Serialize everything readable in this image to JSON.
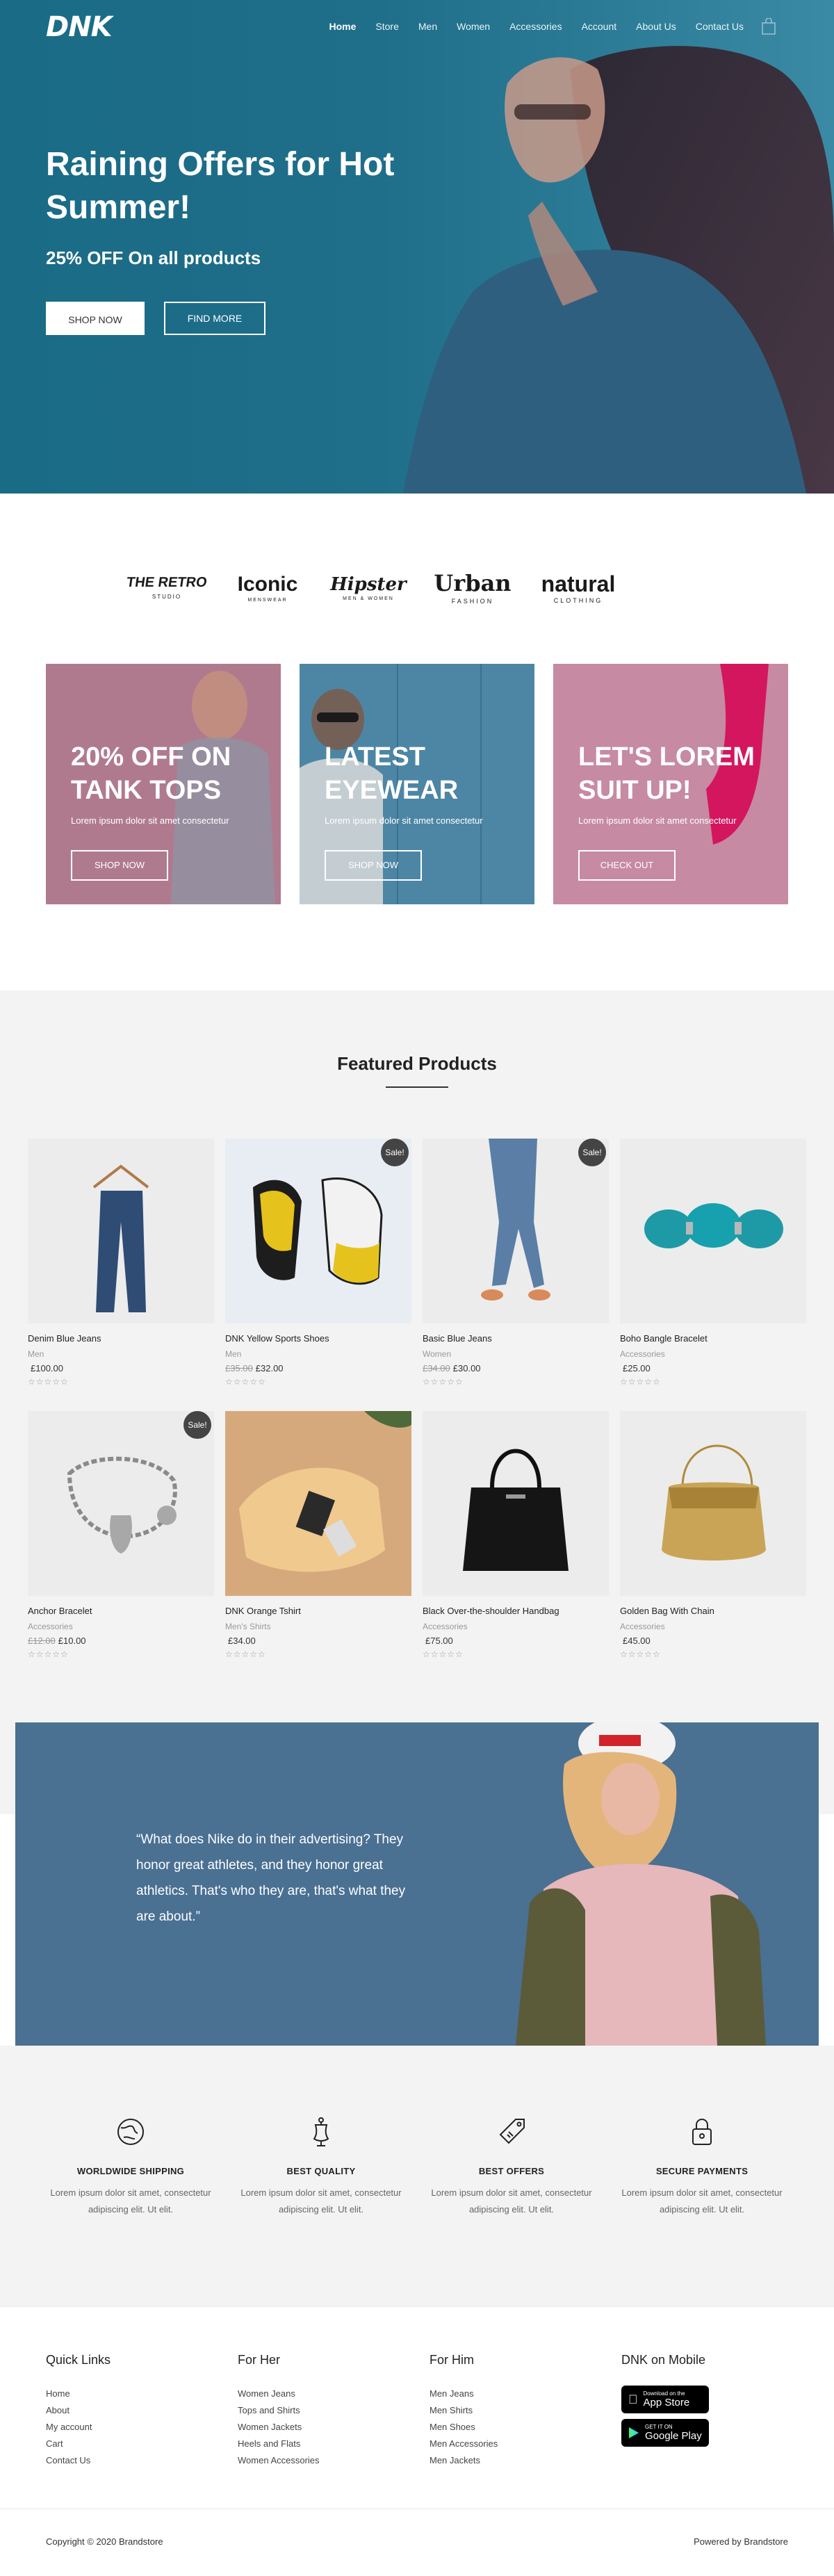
{
  "nav": {
    "logo": "DNK",
    "items": [
      "Home",
      "Store",
      "Men",
      "Women",
      "Accessories",
      "Account",
      "About Us",
      "Contact Us"
    ],
    "active": "Home"
  },
  "hero": {
    "title": "Raining Offers for Hot Summer!",
    "subtitle": "25% OFF On all products",
    "btn_shop": "SHOP NOW",
    "btn_more": "FIND MORE"
  },
  "brands": [
    {
      "name": "THE RETRO",
      "sub": "STUDIO"
    },
    {
      "name": "Iconic",
      "sub": "MENSWEAR"
    },
    {
      "name": "Hipster",
      "sub": "MEN & WOMEN"
    },
    {
      "name": "Urban",
      "sub": "FASHION"
    },
    {
      "name": "natural",
      "sub": "CLOTHING"
    }
  ],
  "promos": [
    {
      "title": "20% OFF ON TANK TOPS",
      "text": "Lorem ipsum dolor sit amet consectetur",
      "button": "SHOP NOW",
      "color": "#b07a8e"
    },
    {
      "title": "LATEST EYEWEAR",
      "text": "Lorem ipsum dolor sit amet consectetur",
      "button": "SHOP NOW",
      "color": "#4d86a5"
    },
    {
      "title": "LET'S LOREM SUIT UP!",
      "text": "Lorem ipsum dolor sit amet consectetur",
      "button": "CHECK OUT",
      "color": "#c68aa3"
    }
  ],
  "featured": {
    "title": "Featured Products",
    "sale_label": "Sale!",
    "stars": "☆☆☆☆☆",
    "products": [
      {
        "name": "Denim Blue Jeans",
        "cat": "Men",
        "old": "",
        "price": "£100.00",
        "sale": false
      },
      {
        "name": "DNK Yellow Sports Shoes",
        "cat": "Men",
        "old": "£35.00",
        "price": "£32.00",
        "sale": true
      },
      {
        "name": "Basic Blue Jeans",
        "cat": "Women",
        "old": "£34.00",
        "price": "£30.00",
        "sale": true
      },
      {
        "name": "Boho Bangle Bracelet",
        "cat": "Accessories",
        "old": "",
        "price": "£25.00",
        "sale": false
      },
      {
        "name": "Anchor Bracelet",
        "cat": "Accessories",
        "old": "£12.00",
        "price": "£10.00",
        "sale": true
      },
      {
        "name": "DNK Orange Tshirt",
        "cat": "Men's Shirts",
        "old": "",
        "price": "£34.00",
        "sale": false
      },
      {
        "name": "Black Over-the-shoulder Handbag",
        "cat": "Accessories",
        "old": "",
        "price": "£75.00",
        "sale": false
      },
      {
        "name": "Golden Bag With Chain",
        "cat": "Accessories",
        "old": "",
        "price": "£45.00",
        "sale": false
      }
    ]
  },
  "testimonial": {
    "quote": "“What does Nike do in their advertising? They honor great athletes, and they honor great athletics. That's who they are, that's what they are about.”"
  },
  "features": [
    {
      "title": "WORLDWIDE SHIPPING",
      "text": "Lorem ipsum dolor sit amet, consectetur adipiscing elit. Ut elit.",
      "icon": "globe-icon"
    },
    {
      "title": "BEST QUALITY",
      "text": "Lorem ipsum dolor sit amet, consectetur adipiscing elit. Ut elit.",
      "icon": "mannequin-icon"
    },
    {
      "title": "BEST OFFERS",
      "text": "Lorem ipsum dolor sit amet, consectetur adipiscing elit. Ut elit.",
      "icon": "tag-icon"
    },
    {
      "title": "SECURE PAYMENTS",
      "text": "Lorem ipsum dolor sit amet, consectetur adipiscing elit. Ut elit.",
      "icon": "lock-icon"
    }
  ],
  "footer": {
    "quick_links": {
      "title": "Quick Links",
      "items": [
        "Home",
        "About",
        "My account",
        "Cart",
        "Contact Us"
      ]
    },
    "for_her": {
      "title": "For Her",
      "items": [
        "Women Jeans",
        "Tops and Shirts",
        "Women Jackets",
        "Heels and Flats",
        "Women Accessories"
      ]
    },
    "for_him": {
      "title": "For Him",
      "items": [
        "Men Jeans",
        "Men Shirts",
        "Men Shoes",
        "Men Accessories",
        "Men Jackets"
      ]
    },
    "mobile": {
      "title": "DNK on Mobile",
      "appstore_small": "Download on the",
      "appstore_big": "App Store",
      "play_small": "GET IT ON",
      "play_big": "Google Play"
    },
    "copyright": "Copyright © 2020 Brandstore",
    "powered": "Powered by Brandstore"
  }
}
